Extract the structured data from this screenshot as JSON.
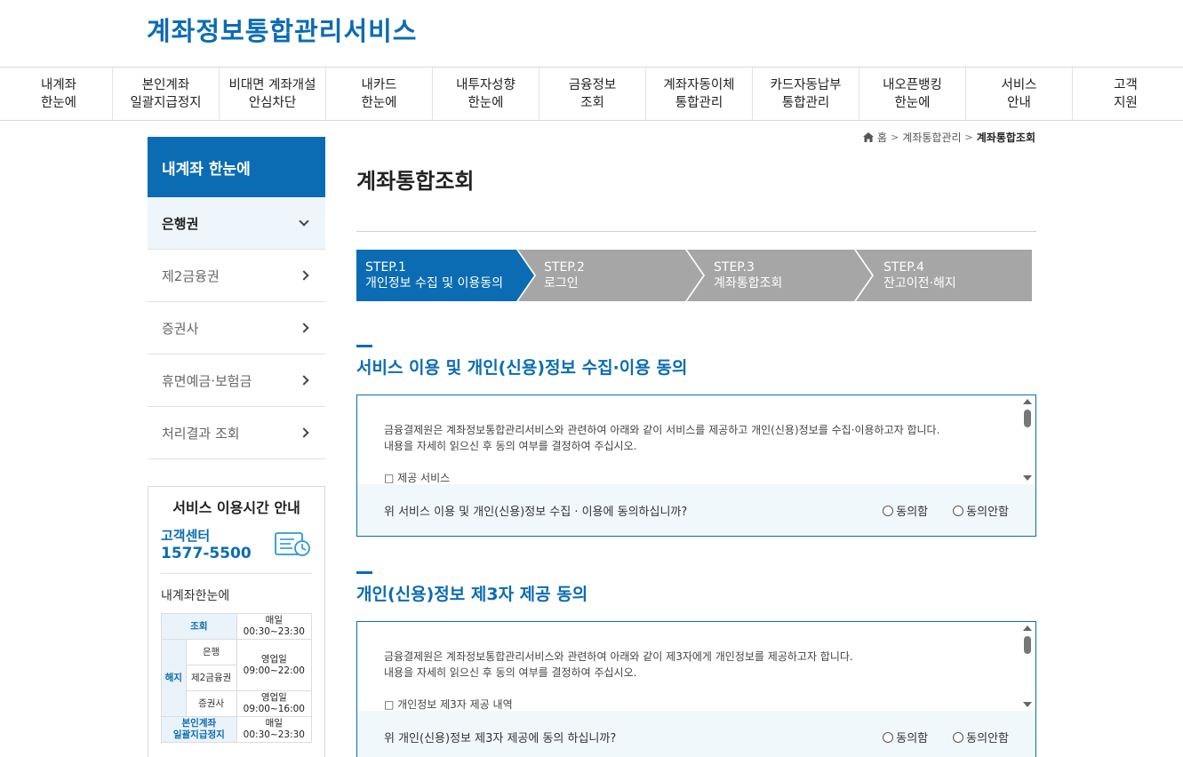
{
  "site": {
    "title": "계좌정보통합관리서비스"
  },
  "gnb": [
    "내계좌\n한눈에",
    "본인계좌\n일괄지급정지",
    "비대면 계좌개설\n안심차단",
    "내카드\n한눈에",
    "내투자성향\n한눈에",
    "금융정보\n조회",
    "계좌자동이체\n통합관리",
    "카드자동납부\n통합관리",
    "내오픈뱅킹\n한눈에",
    "서비스\n안내",
    "고객\n지원"
  ],
  "breadcrumb": {
    "home": "홈",
    "level1": "계좌통합관리",
    "current": "계좌통합조회"
  },
  "sidebar": {
    "title": "내계좌 한눈에",
    "items": [
      "은행권",
      "제2금융권",
      "증권사",
      "휴면예금·보험금",
      "처리결과 조회"
    ]
  },
  "info": {
    "title": "서비스 이용시간 안내",
    "cs_label": "고객센터",
    "cs_phone": "1577-5500",
    "sub": "내계좌한눈에",
    "rows": {
      "inquiry": "조회",
      "inquiry_time": "매일\n00:30~23:30",
      "cancel": "해지",
      "bank": "은행",
      "second": "제2금융권",
      "biz_time": "영업일\n09:00~22:00",
      "securities": "증권사",
      "sec_time": "영업일\n09:00~16:00",
      "stop": "본인계좌\n일괄지급정지",
      "stop_time": "매일\n00:30~23:30"
    }
  },
  "page": {
    "title": "계좌통합조회"
  },
  "steps": [
    {
      "num": "STEP.1",
      "label": "개인정보 수집 및 이용동의"
    },
    {
      "num": "STEP.2",
      "label": "로그인"
    },
    {
      "num": "STEP.3",
      "label": "계좌통합조회"
    },
    {
      "num": "STEP.4",
      "label": "잔고이전·해지"
    }
  ],
  "section1": {
    "title": "서비스 이용 및 개인(신용)정보 수집·이용 동의",
    "line1": "금융결제원은 계좌정보통합관리서비스와 관련하여 아래와 같이 서비스를 제공하고 개인(신용)정보를 수집·이용하고자 합니다.",
    "line2": "내용을 자세히 읽으신 후 동의 여부를 결정하여 주십시오.",
    "item": "□ 제공 서비스",
    "question": "위 서비스 이용 및 개인(신용)정보 수집 · 이용에 동의하십니까?",
    "agree": "동의함",
    "disagree": "동의안함"
  },
  "section2": {
    "title": "개인(신용)정보 제3자 제공 동의",
    "line1": "금융결제원은 계좌정보통합관리서비스와 관련하여 아래와 같이 제3자에게 개인정보를 제공하고자 합니다.",
    "line2": "내용을 자세히 읽으신 후 동의 여부를 결정하여 주십시오.",
    "item": "□ 개인정보 제3자 제공 내역",
    "question": "위 개인(신용)정보 제3자 제공에 동의 하십니까?",
    "agree": "동의함",
    "disagree": "동의안함"
  },
  "colors": {
    "brand": "#0b6cb3",
    "step_active": "#0b6cb3",
    "step_inactive": "#a6a6a6"
  }
}
